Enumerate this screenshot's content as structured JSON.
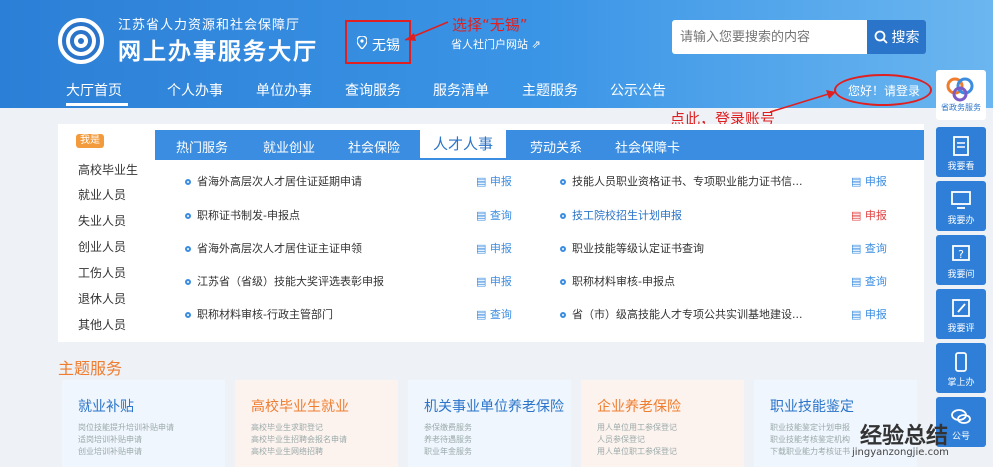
{
  "header": {
    "site_subtitle": "江苏省人力资源和社会保障厅",
    "site_title": "网上办事服务大厅",
    "city": "无锡",
    "portal_link": "省人社门户网站",
    "search_placeholder": "请输入您要搜索的内容",
    "search_button": "搜索"
  },
  "annotations": {
    "select_city": "选择“无锡”",
    "login_hint": "点此，登录账号"
  },
  "nav": {
    "items": [
      "大厅首页",
      "个人办事",
      "单位办事",
      "查询服务",
      "服务清单",
      "主题服务",
      "公示公告"
    ],
    "login": "您好！请登录"
  },
  "left_list": {
    "badge": "我是",
    "items": [
      "高校毕业生",
      "就业人员",
      "失业人员",
      "创业人员",
      "工伤人员",
      "退休人员",
      "其他人员"
    ]
  },
  "tabs": [
    "热门服务",
    "就业创业",
    "社会保险",
    "人才人事",
    "劳动关系",
    "社会保障卡"
  ],
  "services_left": [
    {
      "name": "省海外高层次人才居住证延期申请",
      "action": "申报"
    },
    {
      "name": "职称证书制发-申报点",
      "action": "查询"
    },
    {
      "name": "省海外高层次人才居住证主证申领",
      "action": "申报"
    },
    {
      "name": "江苏省（省级）技能大奖评选表彰申报",
      "action": "申报"
    },
    {
      "name": "职称材料审核-行政主管部门",
      "action": "查询"
    }
  ],
  "services_right": [
    {
      "name": "技能人员职业资格证书、专项职业能力证书信...",
      "action": "申报"
    },
    {
      "name": "技工院校招生计划申报",
      "action": "申报"
    },
    {
      "name": "职业技能等级认定证书查询",
      "action": "查询"
    },
    {
      "name": "职称材料审核-申报点",
      "action": "查询"
    },
    {
      "name": "省（市）级高技能人才专项公共实训基地建设...",
      "action": "申报"
    }
  ],
  "theme": {
    "title": "主题服务",
    "cards": [
      {
        "title": "就业补贴",
        "color": "#2a74c9",
        "lines": [
          "岗位技能提升培训补贴申请",
          "适岗培训补贴申请",
          "创业培训补贴申请"
        ]
      },
      {
        "title": "高校毕业生就业",
        "color": "#f07c2e",
        "lines": [
          "高校毕业生求职登记",
          "高校毕业生招聘会报名申请",
          "高校毕业生网络招聘"
        ]
      },
      {
        "title": "机关事业单位养老保险",
        "color": "#2a74c9",
        "lines": [
          "参保缴费服务",
          "养老待遇服务",
          "职业年金服务"
        ]
      },
      {
        "title": "企业养老保险",
        "color": "#f07c2e",
        "lines": [
          "用人单位用工参保登记",
          "人员参保登记",
          "用人单位职工参保登记"
        ]
      },
      {
        "title": "职业技能鉴定",
        "color": "#2a74c9",
        "lines": [
          "职业技能鉴定计划申报",
          "职业技能考核鉴定机构",
          "下载职业能力考核证书"
        ]
      }
    ]
  },
  "rail": {
    "top_label": "省政务服务",
    "items": [
      "我要看",
      "我要办",
      "我要问",
      "我要评",
      "掌上办",
      "公号"
    ]
  },
  "watermark": {
    "text": "经验总结",
    "url": "jingyanzongjie.com"
  }
}
